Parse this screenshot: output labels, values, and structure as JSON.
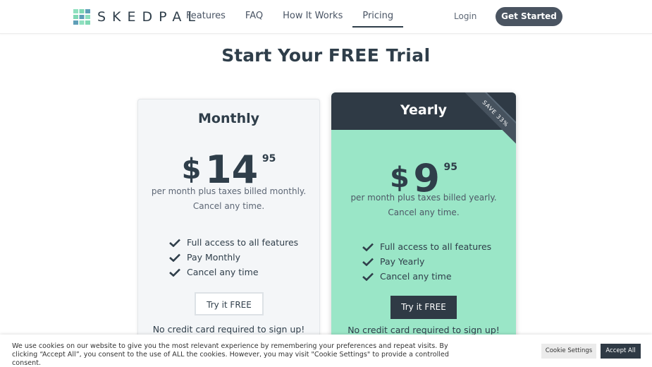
{
  "header": {
    "logo_text": "SKEDPAL",
    "nav": [
      {
        "label": "Features"
      },
      {
        "label": "FAQ"
      },
      {
        "label": "How It Works"
      },
      {
        "label": "Pricing",
        "active": true
      }
    ],
    "login_label": "Login",
    "get_started_label": "Get Started"
  },
  "title": {
    "prefix": "Start Your",
    "highlight": "FREE Trial"
  },
  "plans": {
    "monthly": {
      "name": "Monthly",
      "currency": "$",
      "amount": "14",
      "cents": "95",
      "desc_line1": "per month plus taxes billed monthly.",
      "desc_line2": "Cancel any time.",
      "features": [
        "Full access to all features",
        "Pay Monthly",
        "Cancel any time"
      ],
      "cta": "Try it FREE",
      "note": "No credit card required to sign up!"
    },
    "yearly": {
      "name": "Yearly",
      "ribbon": "SAVE 33%",
      "currency": "$",
      "amount": "9",
      "cents": "95",
      "desc_line1": "per month plus taxes billed yearly.",
      "desc_line2": "Cancel any time.",
      "features": [
        "Full access to all features",
        "Pay Yearly",
        "Cancel any time"
      ],
      "cta": "Try it FREE",
      "note": "No credit card required to sign up!"
    }
  },
  "cookie": {
    "text": "We use cookies on our website to give you the most relevant experience by remembering your preferences and repeat visits. By clicking “Accept All”, you consent to the use of ALL the cookies. However, you may visit \"Cookie Settings\" to provide a controlled consent.",
    "settings_label": "Cookie Settings",
    "accept_label": "Accept All"
  },
  "icons": {
    "logo": "skedpal-logo-icon",
    "check": "checkmark-icon"
  },
  "colors": {
    "dark": "#2f3a45",
    "mint": "#9ae6c7",
    "card_bg": "#f4f6f8"
  }
}
